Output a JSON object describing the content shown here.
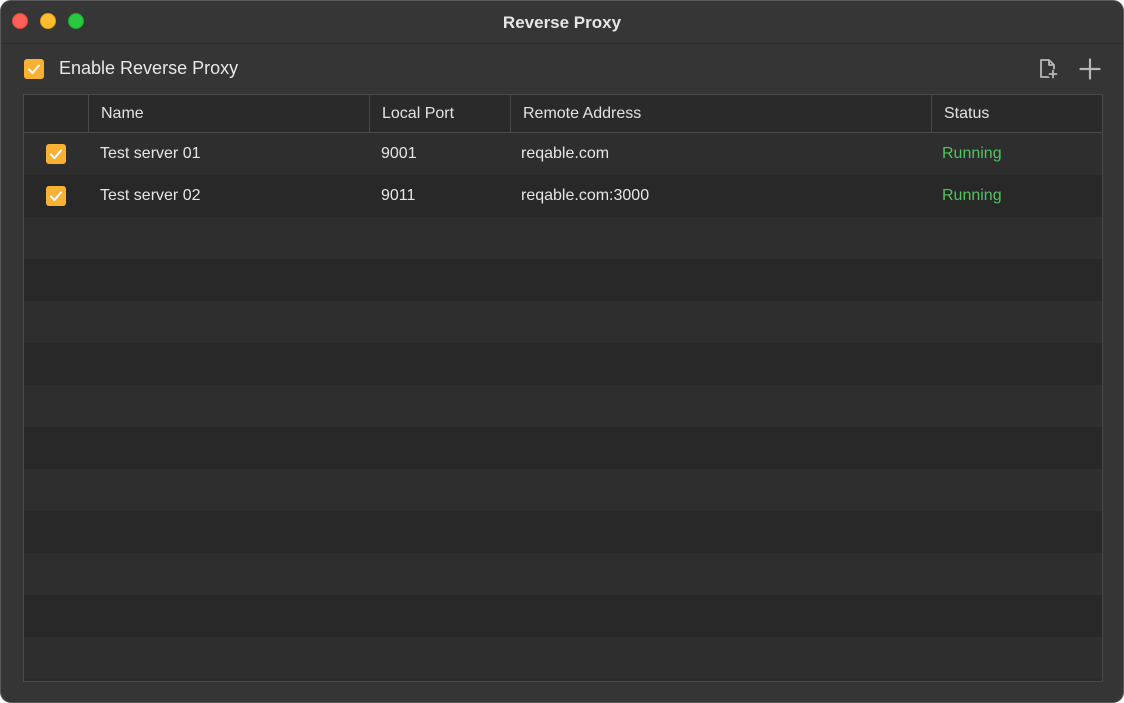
{
  "window": {
    "title": "Reverse Proxy"
  },
  "toolbar": {
    "enable_label": "Enable Reverse Proxy",
    "enable_checked": true,
    "icons": [
      "new-file-icon",
      "add-icon"
    ]
  },
  "table": {
    "columns": [
      "",
      "Name",
      "Local Port",
      "Remote Address",
      "Status"
    ],
    "rows": [
      {
        "checked": true,
        "name": "Test server 01",
        "port": "9001",
        "address": "reqable.com",
        "status": "Running"
      },
      {
        "checked": true,
        "name": "Test server 02",
        "port": "9011",
        "address": "reqable.com:3000",
        "status": "Running"
      }
    ]
  },
  "colors": {
    "accent": "#f8b133",
    "status_running": "#4fc35f",
    "background": "#353535"
  }
}
